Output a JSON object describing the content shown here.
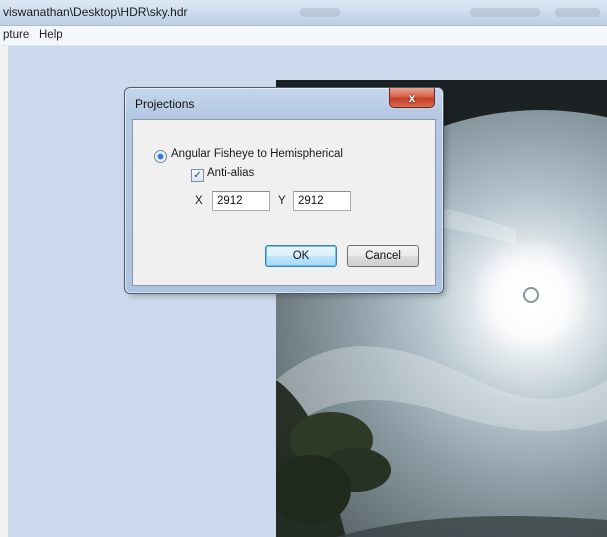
{
  "window": {
    "title": "viswanathan\\Desktop\\HDR\\sky.hdr"
  },
  "menu": {
    "items": [
      "pture",
      "Help"
    ]
  },
  "dialog": {
    "title": "Projections",
    "close_glyph": "x",
    "option_label": "Angular Fisheye to Hemispherical",
    "option_selected": true,
    "antialias_label": "Anti-alias",
    "antialias_checked": true,
    "x_label": "X",
    "x_value": "2912",
    "y_label": "Y",
    "y_value": "2912",
    "ok_label": "OK",
    "cancel_label": "Cancel"
  },
  "colors": {
    "workspace": "#ccd9ec",
    "dialog_frame": "#b4c8e2",
    "close_button": "#c3412a"
  },
  "icons": {
    "close": "close-icon",
    "check": "checkmark-icon",
    "radio": "radio-selected-icon"
  }
}
